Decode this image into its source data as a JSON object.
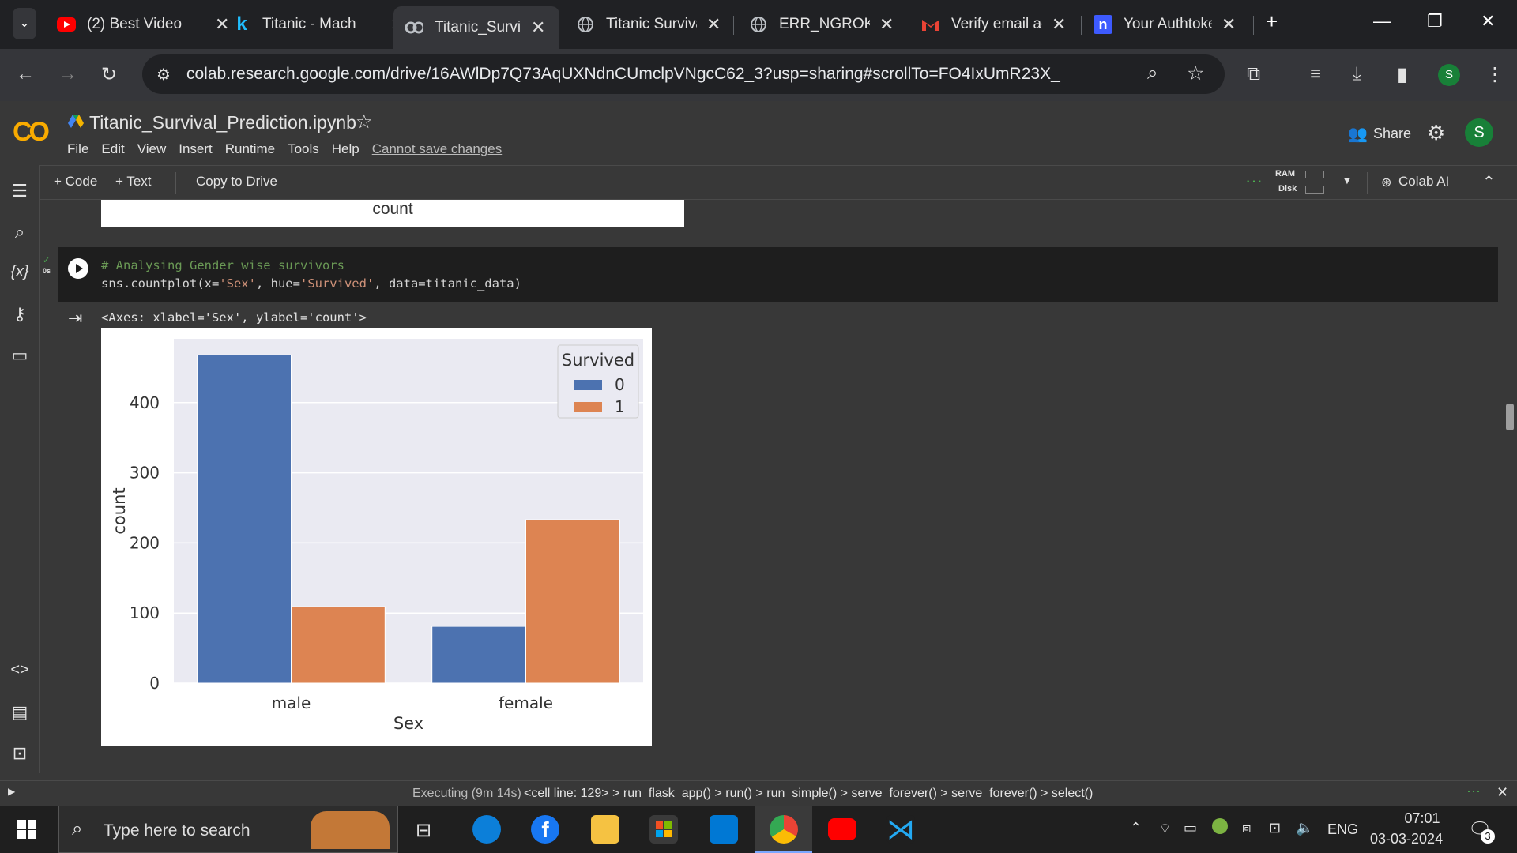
{
  "browser": {
    "tabs": [
      {
        "title": "(2) Best Video",
        "icon": "youtube-icon",
        "color": "#ff0000"
      },
      {
        "title": "Titanic - Mach",
        "icon": "kaggle-icon",
        "color": "#20beff"
      },
      {
        "title": "Titanic_Surviv",
        "icon": "colab-icon",
        "color": "#9aa0a6",
        "active": true
      },
      {
        "title": "Titanic Surviva",
        "icon": "globe-icon",
        "color": "#9aa0a6"
      },
      {
        "title": "ERR_NGROK_(",
        "icon": "globe-icon",
        "color": "#9aa0a6"
      },
      {
        "title": "Verify email ac",
        "icon": "gmail-icon",
        "color": "#ea4335"
      },
      {
        "title": "Your Authtoke",
        "icon": "ngrok-icon",
        "color": "#3d5afe"
      }
    ],
    "url": "colab.research.google.com/drive/16AWlDp7Q73AqUXNdnCUmclpVNgcC62_3?usp=sharing#scrollTo=FO4IxUmR23X_",
    "profile_initial": "S"
  },
  "colab": {
    "notebook_title": "Titanic_Survival_Prediction.ipynb",
    "logo_text": "CO",
    "menu": [
      "File",
      "Edit",
      "View",
      "Insert",
      "Runtime",
      "Tools",
      "Help"
    ],
    "unsaved_label": "Cannot save changes",
    "share_label": "Share",
    "user_initial": "S",
    "toolbar": {
      "code_label": "+ Code",
      "text_label": "+ Text",
      "copy_label": "Copy to Drive",
      "ram_label": "RAM",
      "disk_label": "Disk",
      "colab_ai_label": "Colab AI"
    }
  },
  "notebook": {
    "prev_output_text": "count",
    "cell_exec_time": "0s",
    "code_comment": "# Analysing Gender wise survivors",
    "code_line_prefix": "sns.countplot(x=",
    "code_str1": "'Sex'",
    "code_mid1": ", hue=",
    "code_str2": "'Survived'",
    "code_tail": ", data=titanic_data)",
    "output_text": "<Axes: xlabel='Sex', ylabel='count'>"
  },
  "chart_data": {
    "type": "bar",
    "categories": [
      "male",
      "female"
    ],
    "series": [
      {
        "name": "0",
        "values": [
          468,
          81
        ],
        "color": "#4c72b0"
      },
      {
        "name": "1",
        "values": [
          109,
          233
        ],
        "color": "#dd8452"
      }
    ],
    "xlabel": "Sex",
    "ylabel": "count",
    "yticks": [
      0,
      100,
      200,
      300,
      400
    ],
    "ylim": [
      0,
      491
    ],
    "legend_title": "Survived",
    "legend_position": "top-right",
    "grid": true,
    "background": "#eaeaf2"
  },
  "status": {
    "executing": "Executing (9m 14s)",
    "trace": "<cell line: 129> > run_flask_app() > run() > run_simple() > serve_forever() > serve_forever() > select()"
  },
  "taskbar": {
    "search_placeholder": "Type here to search",
    "lang": "ENG",
    "time": "07:01",
    "date": "03-03-2024",
    "notif_count": "3"
  }
}
